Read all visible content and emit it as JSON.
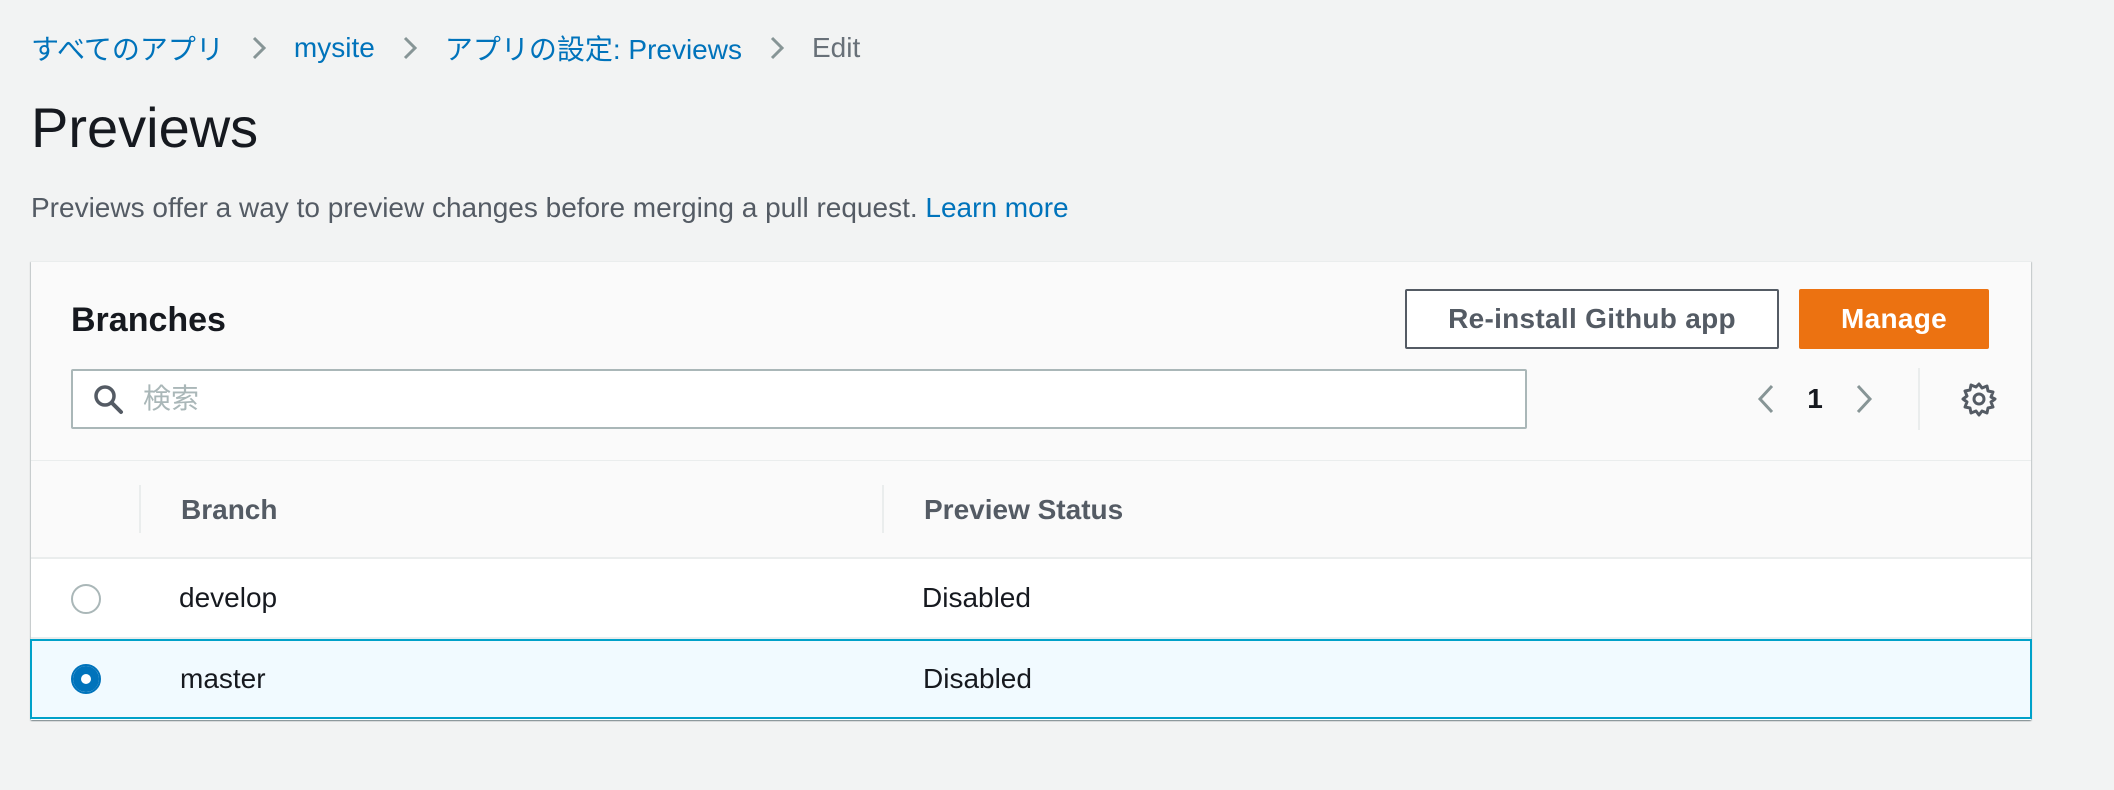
{
  "breadcrumb": {
    "items": [
      "すべてのアプリ",
      "mysite",
      "アプリの設定: Previews"
    ],
    "current": "Edit"
  },
  "page": {
    "title": "Previews",
    "description": "Previews offer a way to preview changes before merging a pull request.",
    "learn_more": "Learn more"
  },
  "branches_panel": {
    "title": "Branches",
    "reinstall_label": "Re-install Github app",
    "manage_label": "Manage",
    "search_placeholder": "検索",
    "search_value": "",
    "current_page": "1"
  },
  "table": {
    "columns": [
      "Branch",
      "Preview Status"
    ],
    "rows": [
      {
        "branch": "develop",
        "status": "Disabled",
        "selected": false
      },
      {
        "branch": "master",
        "status": "Disabled",
        "selected": true
      }
    ]
  },
  "colors": {
    "link": "#0073bb",
    "primary_button": "#ec7211",
    "selected_row_bg": "#f1faff",
    "selected_row_border": "#00a1c9"
  },
  "icons": {
    "breadcrumb_separator": "chevron-right-icon",
    "search": "search-icon",
    "prev_page": "chevron-left-icon",
    "next_page": "chevron-right-icon",
    "settings": "gear-icon"
  }
}
